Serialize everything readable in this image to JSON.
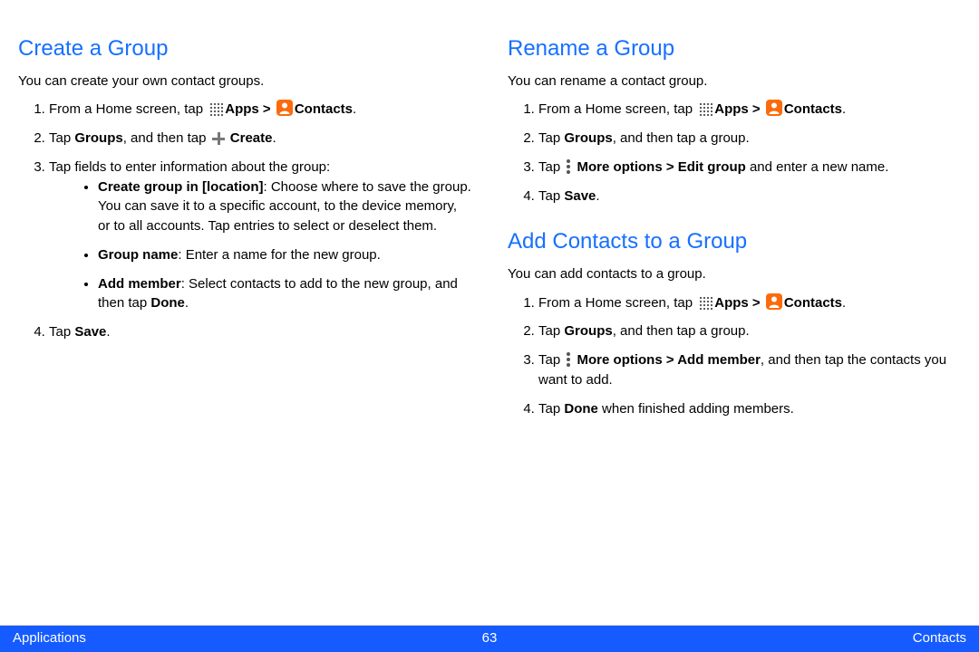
{
  "left": {
    "create": {
      "heading": "Create a Group",
      "intro": "You can create your own contact groups.",
      "step1_a": "From a Home screen, tap ",
      "step1_apps": "Apps > ",
      "step1_contacts": "Contacts",
      "step1_end": ".",
      "step2_a": "Tap ",
      "step2_groups": "Groups",
      "step2_b": ", and then tap ",
      "step2_create": " Create",
      "step2_end": ".",
      "step3": "Tap fields to enter information about the group:",
      "bullet1_label": "Create group in [location]",
      "bullet1_text": ": Choose where to save the group. You can save it to a specific account, to the device memory, or to all accounts. Tap entries to select or deselect them.",
      "bullet2_label": "Group name",
      "bullet2_text": ": Enter a name for the new group.",
      "bullet3_label": "Add member",
      "bullet3_text_a": ": Select contacts to add to the new group, and then tap ",
      "bullet3_done": "Done",
      "bullet3_text_b": ".",
      "step4_a": "Tap ",
      "step4_save": "Save",
      "step4_end": "."
    }
  },
  "right": {
    "rename": {
      "heading": "Rename a Group",
      "intro": "You can rename a contact group.",
      "step1_a": "From a Home screen, tap ",
      "step1_apps": "Apps > ",
      "step1_contacts": "Contacts",
      "step1_end": ".",
      "step2_a": "Tap ",
      "step2_groups": "Groups",
      "step2_b": ", and then tap a group.",
      "step3_a": "Tap ",
      "step3_more": " More options > Edit group",
      "step3_b": " and enter a new name.",
      "step4_a": "Tap ",
      "step4_save": "Save",
      "step4_end": "."
    },
    "add": {
      "heading": "Add Contacts to a Group",
      "intro": "You can add contacts to a group.",
      "step1_a": "From a Home screen, tap ",
      "step1_apps": "Apps > ",
      "step1_contacts": "Contacts",
      "step1_end": ".",
      "step2_a": "Tap ",
      "step2_groups": "Groups",
      "step2_b": ", and then tap a group.",
      "step3_a": "Tap ",
      "step3_more": " More options > Add member",
      "step3_b": ", and then tap the contacts you want to add.",
      "step4_a": "Tap ",
      "step4_done": "Done",
      "step4_b": " when finished adding members."
    }
  },
  "footer": {
    "left": "Applications",
    "center": "63",
    "right": "Contacts"
  }
}
